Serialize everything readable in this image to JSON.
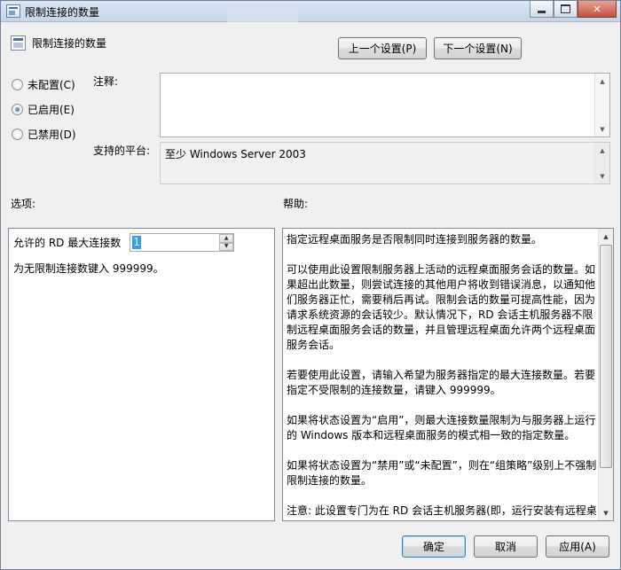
{
  "window": {
    "title": "限制连接的数量"
  },
  "header": {
    "setting_title": "限制连接的数量",
    "prev_setting_button": "上一个设置(P)",
    "next_setting_button": "下一个设置(N)"
  },
  "state": {
    "options": [
      {
        "label": "未配置(C)",
        "checked": false
      },
      {
        "label": "已启用(E)",
        "checked": true
      },
      {
        "label": "已禁用(D)",
        "checked": false
      }
    ]
  },
  "comment": {
    "label": "注释:",
    "value": ""
  },
  "platform": {
    "label": "支持的平台:",
    "value": "至少 Windows Server 2003"
  },
  "options_panel": {
    "heading": "选项:",
    "max_connections_label": "允许的 RD 最大连接数",
    "max_connections_value": "1",
    "hint": "为无限制连接数键入 999999。"
  },
  "help_panel": {
    "heading": "帮助:",
    "paragraphs": [
      "指定远程桌面服务是否限制同时连接到服务器的数量。",
      "可以使用此设置限制服务器上活动的远程桌面服务会话的数量。如果超出此数量，则尝试连接的其他用户将收到错误消息，以通知他们服务器正忙，需要稍后再试。限制会话的数量可提高性能，因为请求系统资源的会话较少。默认情况下，RD 会话主机服务器不限制远程桌面服务会话的数量，并且管理远程桌面允许两个远程桌面服务会话。",
      "若要使用此设置，请输入希望为服务器指定的最大连接数量。若要指定不受限制的连接数量，请键入 999999。",
      "如果将状态设置为“启用”，则最大连接数量限制为与服务器上运行的 Windows 版本和远程桌面服务的模式相一致的指定数量。",
      "如果将状态设置为“禁用”或“未配置”，则在“组策略”级别上不强制限制连接的数量。",
      "注意: 此设置专门为在 RD 会话主机服务器(即，运行安装有远程桌"
    ]
  },
  "footer": {
    "ok_button": "确定",
    "cancel_button": "取消",
    "apply_button": "应用(A)"
  },
  "colors": {
    "dialog_bg": "#f0f0f0",
    "selection": "#3399ff",
    "default_button_border": "#3c7fb1"
  }
}
